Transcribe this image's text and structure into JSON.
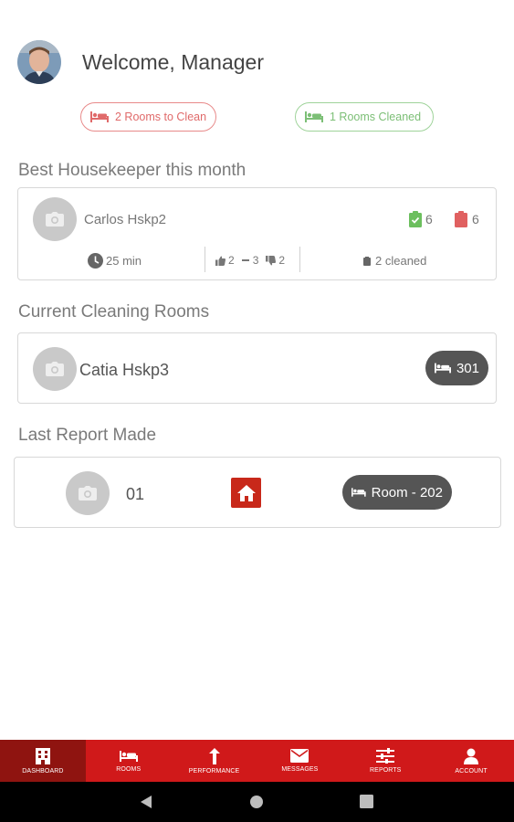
{
  "header": {
    "welcome": "Welcome, Manager"
  },
  "summary": {
    "rooms_to_clean": "2 Rooms to Clean",
    "rooms_cleaned": "1  Rooms Cleaned"
  },
  "best_housekeeper": {
    "section_title": "Best Housekeeper this month",
    "name": "Carlos Hskp2",
    "approved_count": "6",
    "rejected_count": "6",
    "avg_time": "25 min",
    "thumbs_up": "2",
    "neutral": "3",
    "thumbs_down": "2",
    "cleaned": "2 cleaned"
  },
  "current_cleaning": {
    "section_title": "Current Cleaning Rooms",
    "name": "Catia Hskp3",
    "room": "301"
  },
  "last_report": {
    "section_title": "Last Report Made",
    "number": "01",
    "room": "Room - 202"
  },
  "nav": {
    "items": [
      {
        "label": "DASHBOARD",
        "icon": "building-icon",
        "active": true
      },
      {
        "label": "ROOMS",
        "icon": "bed-icon"
      },
      {
        "label": "PERFORMANCE",
        "icon": "arrow-up-icon"
      },
      {
        "label": "MESSAGES",
        "icon": "envelope-icon"
      },
      {
        "label": "REPORTS",
        "icon": "sliders-icon"
      },
      {
        "label": "ACCOUNT",
        "icon": "user-icon"
      }
    ]
  },
  "colors": {
    "brand_red": "#d0191a",
    "active_tab": "#8f1410",
    "to_clean": "#e06a6a",
    "cleaned": "#7cbf76",
    "room_pill": "#555555",
    "home_badge": "#c8281a"
  }
}
